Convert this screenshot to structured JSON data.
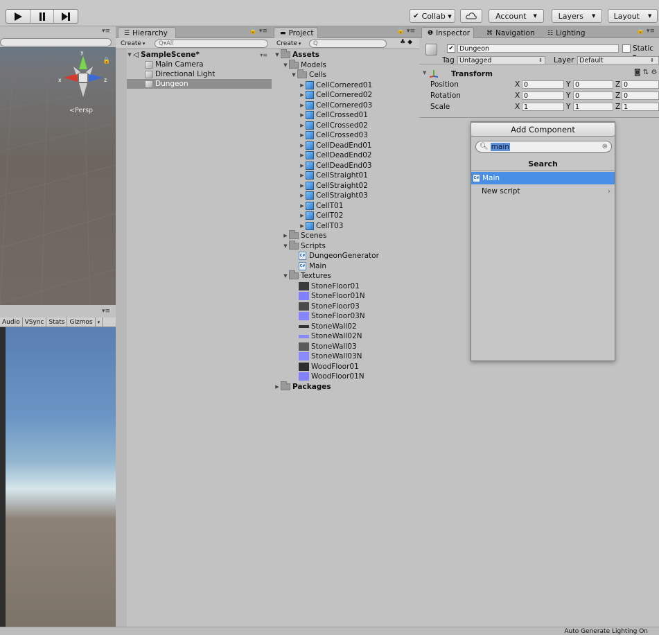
{
  "toolbar": {
    "collab_label": "Collab ▾",
    "account_label": "Account",
    "layers_label": "Layers",
    "layout_label": "Layout"
  },
  "scene": {
    "persp_label": "Persp",
    "gizmo": {
      "x": "x",
      "y": "y",
      "z": "z"
    }
  },
  "game": {
    "toolbar_items": [
      "Audio",
      "VSync",
      "Stats",
      "Gizmos"
    ]
  },
  "hierarchy": {
    "tab_label": "Hierarchy",
    "create_label": "Create",
    "search_placeholder": "Q▾All",
    "scene_name": "SampleScene*",
    "items": [
      {
        "label": "Main Camera",
        "selected": false
      },
      {
        "label": "Directional Light",
        "selected": false
      },
      {
        "label": "Dungeon",
        "selected": true
      }
    ]
  },
  "project": {
    "tab_label": "Project",
    "create_label": "Create",
    "search_placeholder": "Q",
    "assets_label": "Assets",
    "models_label": "Models",
    "cells_label": "Cells",
    "cells": [
      "CellCornered01",
      "CellCornered02",
      "CellCornered03",
      "CellCrossed01",
      "CellCrossed02",
      "CellCrossed03",
      "CellDeadEnd01",
      "CellDeadEnd02",
      "CellDeadEnd03",
      "CellStraight01",
      "CellStraight02",
      "CellStraight03",
      "CellT01",
      "CellT02",
      "CellT03"
    ],
    "scenes_label": "Scenes",
    "scripts_label": "Scripts",
    "scripts": [
      "DungeonGenerator",
      "Main"
    ],
    "textures_label": "Textures",
    "textures": [
      {
        "name": "StoneFloor01",
        "color": "#3b3b3b"
      },
      {
        "name": "StoneFloor01N",
        "color": "#8080ff"
      },
      {
        "name": "StoneFloor03",
        "color": "#4a4a4a"
      },
      {
        "name": "StoneFloor03N",
        "color": "#8585ff"
      },
      {
        "name": "StoneWall02",
        "color": "#333333"
      },
      {
        "name": "StoneWall02N",
        "color": "#8888ff"
      },
      {
        "name": "StoneWall03",
        "color": "#5a5a5a"
      },
      {
        "name": "StoneWall03N",
        "color": "#8a8aff"
      },
      {
        "name": "WoodFloor01",
        "color": "#2e2e2e"
      },
      {
        "name": "WoodFloor01N",
        "color": "#8282ff"
      }
    ],
    "packages_label": "Packages"
  },
  "inspector": {
    "tabs": [
      "Inspector",
      "Navigation",
      "Lighting"
    ],
    "object_name": "Dungeon",
    "static_label": "Static",
    "tag_label": "Tag",
    "tag_value": "Untagged",
    "layer_label": "Layer",
    "layer_value": "Default",
    "transform_label": "Transform",
    "position_label": "Position",
    "rotation_label": "Rotation",
    "scale_label": "Scale",
    "position": {
      "x": "0",
      "y": "0",
      "z": "0"
    },
    "rotation": {
      "x": "0",
      "y": "0",
      "z": "0"
    },
    "scale": {
      "x": "1",
      "y": "1",
      "z": "1"
    },
    "axis": {
      "x": "X",
      "y": "Y",
      "z": "Z"
    },
    "add_component_label": "Add Component",
    "search_value": "main",
    "search_header": "Search",
    "results": [
      "Main",
      "New script"
    ]
  },
  "status": {
    "text": "Auto Generate Lighting On"
  },
  "colors": {
    "selection_blue": "#4a8fe6",
    "panel_bg": "#c2c2c2"
  }
}
